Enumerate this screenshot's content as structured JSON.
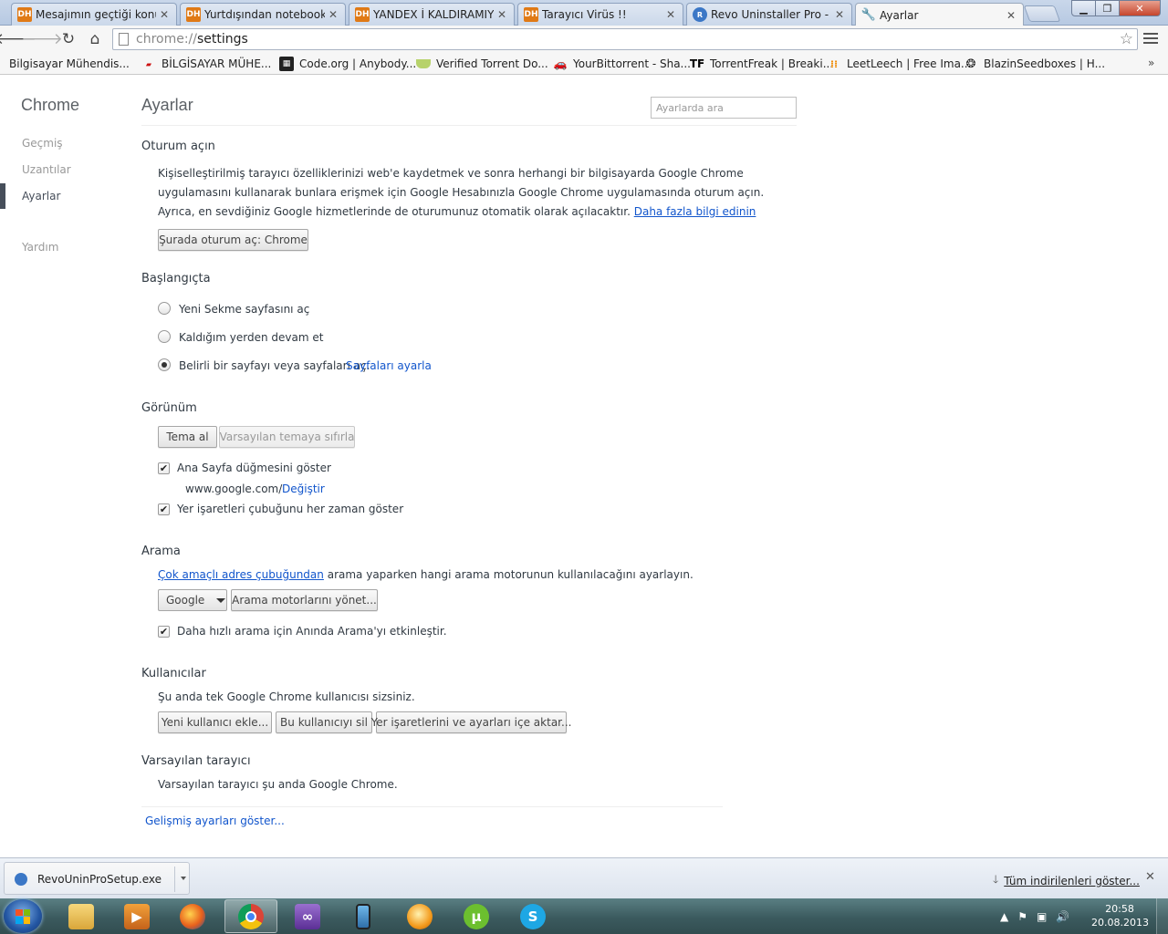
{
  "tabs": [
    {
      "title": "Mesajımın geçtiği konula",
      "icon": "DH"
    },
    {
      "title": "Yurtdışından notebook a",
      "icon": "DH"
    },
    {
      "title": "YANDEX İ KALDIRAMIYO",
      "icon": "DH"
    },
    {
      "title": "Tarayıcı Virüs !!",
      "icon": "DH"
    },
    {
      "title": "Revo Uninstaller Pro - Un",
      "icon": "revo-icon"
    },
    {
      "title": "Ayarlar",
      "icon": "wrench-icon"
    }
  ],
  "omnibox": {
    "scheme": "chrome://",
    "path": "settings"
  },
  "bookmarks": [
    "Bilgisayar Mühendis...",
    "BİLGİSAYAR MÜHE...",
    "Code.org | Anybody...",
    "Verified Torrent Do...",
    "YourBittorrent - Sha...",
    "TorrentFreak | Breaki...",
    "LeetLeech | Free Ima...",
    "BlazinSeedboxes | H..."
  ],
  "bookmarks_more": "»",
  "nav": {
    "title": "Chrome",
    "items": [
      "Geçmiş",
      "Uzantılar",
      "Ayarlar",
      "Yardım"
    ]
  },
  "page_title": "Ayarlar",
  "search_placeholder": "Ayarlarda ara",
  "signin": {
    "title": "Oturum açın",
    "line1": "Kişiselleştirilmiş tarayıcı özelliklerinizi web'e kaydetmek ve sonra herhangi bir bilgisayarda Google Chrome",
    "line2": "uygulamasını kullanarak bunlara erişmek için Google Hesabınızla Google Chrome uygulamasında oturum açın.",
    "line3": "Ayrıca, en sevdiğiniz Google hizmetlerinde de oturumunuz otomatik olarak açılacaktır.",
    "learn_more": "Daha fazla bilgi edinin",
    "button": "Şurada oturum aç: Chrome"
  },
  "startup": {
    "title": "Başlangıçta",
    "options": [
      "Yeni Sekme sayfasını aç",
      "Kaldığım yerden devam et",
      "Belirli bir sayfayı veya sayfaları aç."
    ],
    "set_pages": "Sayfaları ayarla"
  },
  "appearance": {
    "title": "Görünüm",
    "get_themes": "Tema al",
    "reset_theme": "Varsayılan temaya sıfırla",
    "show_home": "Ana Sayfa düğmesini göster",
    "home_url": "www.google.com/",
    "change": "Değiştir",
    "show_bookmarks": "Yer işaretleri çubuğunu her zaman göster"
  },
  "search": {
    "title": "Arama",
    "omnibox_link": "Çok amaçlı adres çubuğundan",
    "desc": "arama yaparken hangi arama motorunun kullanılacağını ayarlayın.",
    "engine": "Google",
    "manage": "Arama motorlarını yönet...",
    "instant": "Daha hızlı arama için Anında Arama'yı etkinleştir."
  },
  "users": {
    "title": "Kullanıcılar",
    "desc": "Şu anda tek Google Chrome kullanıcısı sizsiniz.",
    "add": "Yeni kullanıcı ekle...",
    "remove": "Bu kullanıcıyı sil",
    "import": "Yer işaretlerini ve ayarları içe aktar..."
  },
  "default_browser": {
    "title": "Varsayılan tarayıcı",
    "desc": "Varsayılan tarayıcı şu anda Google Chrome."
  },
  "advanced_link": "Gelişmiş ayarları göster...",
  "download": {
    "file": "RevoUninProSetup.exe",
    "show_all": "Tüm indirilenleri göster..."
  },
  "clock": {
    "time": "20:58",
    "date": "20.08.2013"
  }
}
